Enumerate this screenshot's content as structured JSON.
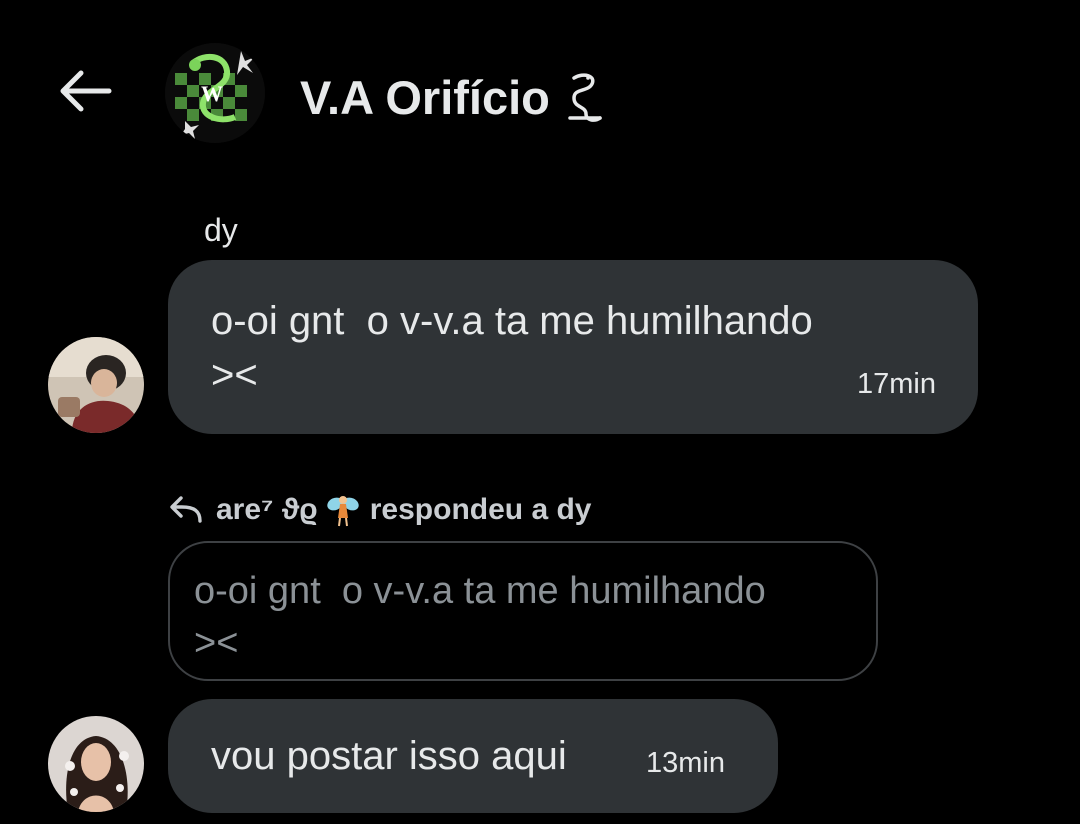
{
  "header": {
    "back_icon": "arrow-left-icon",
    "group_avatar": "group-avatar-image",
    "title": "V.A Orifício",
    "title_emoji_icon": "snake-emoji-icon"
  },
  "messages": [
    {
      "sender": "dy",
      "avatar": "user-avatar-dy",
      "text": "o-oi gnt  o v-v.a ta me humilhando\n><",
      "time": "17min"
    },
    {
      "reply_icon": "reply-arrow-icon",
      "reply_author": "are⁷ ϑϱ",
      "reply_author_emoji": "fairy-emoji-icon",
      "reply_label": "respondeu a dy",
      "quoted_text": "o-oi gnt  o v-v.a ta me humilhando\n><",
      "avatar": "user-avatar-are",
      "text": "vou postar isso aqui",
      "time": "13min"
    }
  ],
  "colors": {
    "background": "#000000",
    "bubble": "#2f3336",
    "text": "#e7e9ea",
    "muted_text": "#8b9196",
    "quote_border": "#3e4144"
  }
}
